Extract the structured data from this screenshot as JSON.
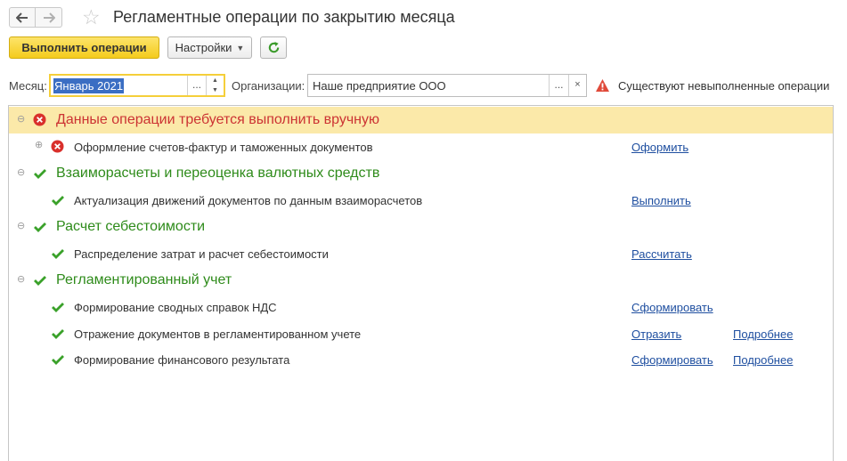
{
  "window": {
    "title": "Регламентные операции по закрытию месяца"
  },
  "nav": {
    "back_icon": "arrow-left-icon",
    "forward_icon": "arrow-right-icon",
    "favorite_icon": "star-icon"
  },
  "toolbar": {
    "run_label": "Выполнить операции",
    "settings_label": "Настройки",
    "refresh_icon": "refresh-icon"
  },
  "filters": {
    "month_label": "Месяц:",
    "month_value": "Январь 2021",
    "org_label": "Организации:",
    "org_value": "Наше предприятие ООО",
    "choose_label": "...",
    "clear_label": "×",
    "warning_text": "Существуют невыполненные операции"
  },
  "colors": {
    "error": "#cc3333",
    "success": "#2e8b1a",
    "highlight": "#fbe9a9",
    "link": "#1f4fa0",
    "primary_button": "#f4cb1c"
  },
  "groups": [
    {
      "status": "error",
      "label": "Данные операции требуется выполнить вручную",
      "items": [
        {
          "status": "error",
          "label": "Оформление счетов-фактур и таможенных документов",
          "action": "Оформить",
          "details": ""
        }
      ]
    },
    {
      "status": "done",
      "label": "Взаиморасчеты и переоценка валютных средств",
      "items": [
        {
          "status": "done",
          "label": "Актуализация движений документов по данным взаиморасчетов",
          "action": "Выполнить",
          "details": ""
        }
      ]
    },
    {
      "status": "done",
      "label": "Расчет себестоимости",
      "items": [
        {
          "status": "done",
          "label": "Распределение затрат и расчет себестоимости",
          "action": "Рассчитать",
          "details": ""
        }
      ]
    },
    {
      "status": "done",
      "label": "Регламентированный учет",
      "items": [
        {
          "status": "done",
          "label": "Формирование сводных справок НДС",
          "action": "Сформировать",
          "details": ""
        },
        {
          "status": "done",
          "label": "Отражение документов в регламентированном учете",
          "action": "Отразить",
          "details": "Подробнее"
        },
        {
          "status": "done",
          "label": "Формирование финансового результата",
          "action": "Сформировать",
          "details": "Подробнее"
        }
      ]
    }
  ]
}
